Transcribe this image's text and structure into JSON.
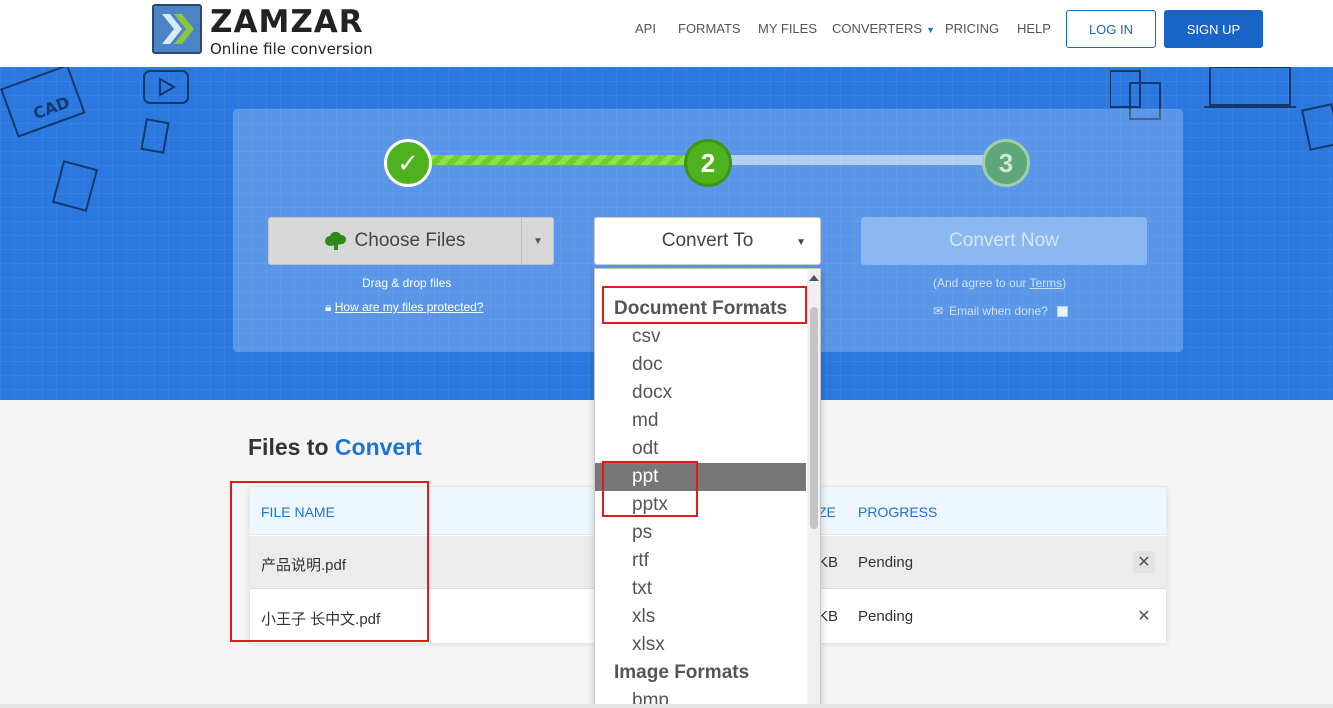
{
  "brand": {
    "name": "ZAMZAR",
    "tm": "™",
    "tagline": "Online file conversion"
  },
  "nav": {
    "items": [
      "API",
      "FORMATS",
      "MY FILES",
      "CONVERTERS",
      "PRICING",
      "HELP"
    ],
    "login": "LOG IN",
    "signup": "SIGN UP"
  },
  "steps": {
    "step1": "✓",
    "step2": "2",
    "step3": "3"
  },
  "upload": {
    "choose_files": "Choose Files",
    "drag_drop": "Drag & drop files",
    "protected_link": "How are my files protected?"
  },
  "convert_to": {
    "label": "Convert To"
  },
  "convert_now": {
    "label": "Convert Now",
    "agree_prefix": "(And agree to our ",
    "agree_terms": "Terms",
    "agree_suffix": ")",
    "email_done": "Email when done?"
  },
  "files": {
    "title_prefix": "Files to",
    "title_accent": "Convert",
    "columns": [
      "FILE NAME",
      "ZE",
      "PROGRESS"
    ],
    "rows": [
      {
        "name": "产品说明.pdf",
        "size": "KB",
        "progress": "Pending"
      },
      {
        "name": "小王子 长中文.pdf",
        "size": "KB",
        "progress": "Pending"
      }
    ]
  },
  "dropdown": {
    "groups": [
      {
        "label": "Document Formats",
        "items": [
          "csv",
          "doc",
          "docx",
          "md",
          "odt",
          "ppt",
          "pptx",
          "ps",
          "rtf",
          "txt",
          "xls",
          "xlsx"
        ]
      },
      {
        "label": "Image Formats",
        "items": [
          "bmp"
        ]
      }
    ],
    "selected": "ppt"
  },
  "colors": {
    "accent": "#1e73d6",
    "hero_bg": "#2b79e0",
    "step_done": "#4db21e",
    "annotation": "#e01b1b"
  }
}
